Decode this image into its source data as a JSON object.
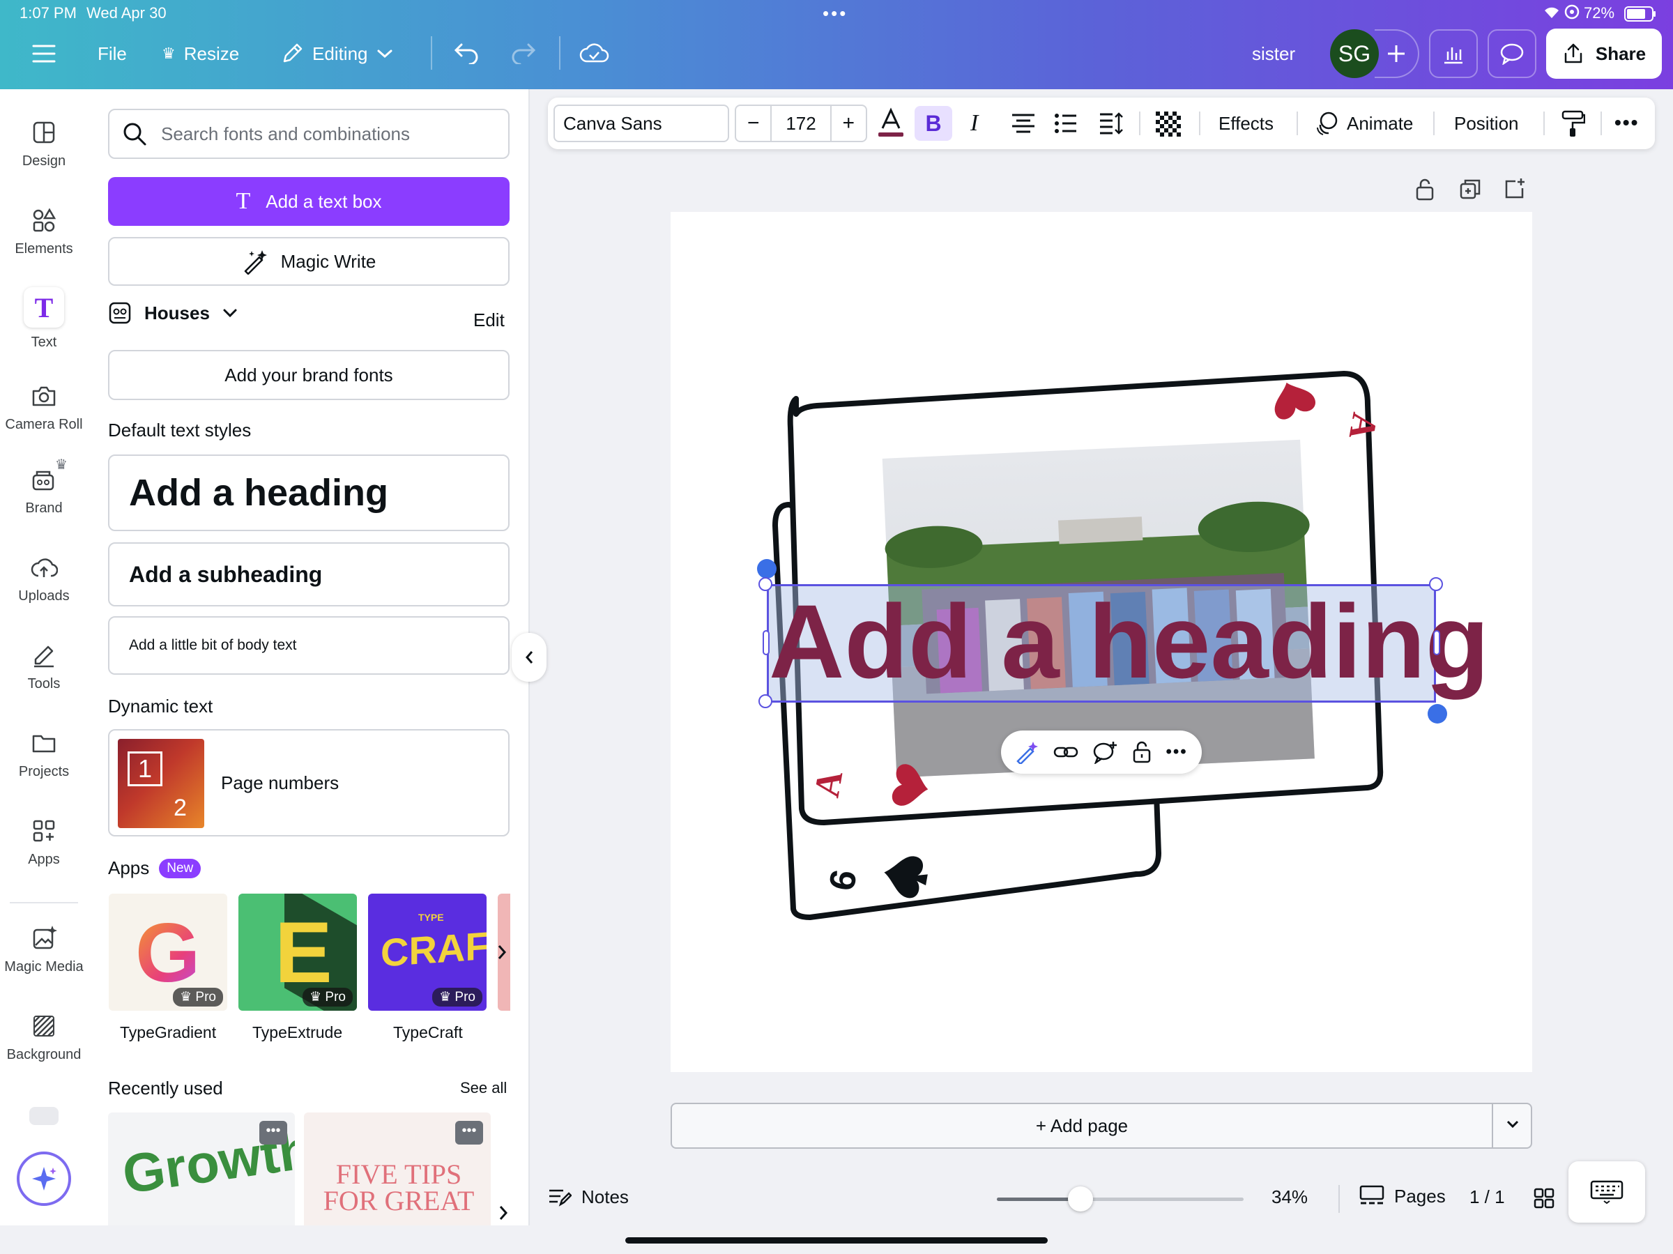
{
  "status": {
    "time": "1:07 PM",
    "date": "Wed Apr 30",
    "battery": "72%"
  },
  "topbar": {
    "file": "File",
    "resize": "Resize",
    "editing": "Editing",
    "project_name": "sister",
    "avatar_initials": "SG",
    "share": "Share"
  },
  "rail": {
    "items": [
      {
        "label": "Design",
        "icon": "design-icon"
      },
      {
        "label": "Elements",
        "icon": "elements-icon"
      },
      {
        "label": "Text",
        "icon": "text-icon"
      },
      {
        "label": "Camera Roll",
        "icon": "camera-icon"
      },
      {
        "label": "Brand",
        "icon": "brand-icon"
      },
      {
        "label": "Uploads",
        "icon": "upload-icon"
      },
      {
        "label": "Tools",
        "icon": "tools-icon"
      },
      {
        "label": "Projects",
        "icon": "folder-icon"
      },
      {
        "label": "Apps",
        "icon": "apps-icon"
      },
      {
        "label": "Magic Media",
        "icon": "magic-media-icon"
      },
      {
        "label": "Background",
        "icon": "background-icon"
      }
    ]
  },
  "panel": {
    "search_placeholder": "Search fonts and combinations",
    "add_text_box": "Add a text box",
    "magic_write": "Magic Write",
    "brand_kit": "Houses",
    "edit": "Edit",
    "add_brand_fonts": "Add your brand fonts",
    "default_styles_title": "Default text styles",
    "heading": "Add a heading",
    "subheading": "Add a subheading",
    "body": "Add a little bit of body text",
    "dynamic_title": "Dynamic text",
    "page_numbers": "Page numbers",
    "page_numbers_thumb": {
      "n1": "1",
      "n2": "2"
    },
    "apps_title": "Apps",
    "apps_badge": "New",
    "apps": [
      {
        "name": "TypeGradient",
        "badge": "Pro",
        "glyph": "G"
      },
      {
        "name": "TypeExtrude",
        "badge": "Pro",
        "glyph": "E"
      },
      {
        "name": "TypeCraft",
        "badge": "Pro",
        "glyph": "CRAFT",
        "sub": "TYPE"
      }
    ],
    "recent_title": "Recently used",
    "see_all": "See all",
    "recent": [
      {
        "text": "Growth",
        "color": "#3a8f3e"
      },
      {
        "text": "FIVE TIPS FOR GREAT",
        "color": "#e0707a"
      }
    ]
  },
  "toolbar": {
    "font": "Canva Sans",
    "size": "172",
    "bold": "B",
    "italic": "I",
    "effects": "Effects",
    "animate": "Animate",
    "position": "Position"
  },
  "canvas": {
    "heading_text": "Add a heading",
    "heading_color": "#7d2347",
    "card_top_rank": "A",
    "card_bottom_rank": "A",
    "back_card_rank": "6"
  },
  "bottom": {
    "add_page": "+ Add page",
    "notes": "Notes",
    "zoom": "34%",
    "zoom_fraction": 0.34,
    "pages": "Pages",
    "page_count": "1 / 1"
  }
}
